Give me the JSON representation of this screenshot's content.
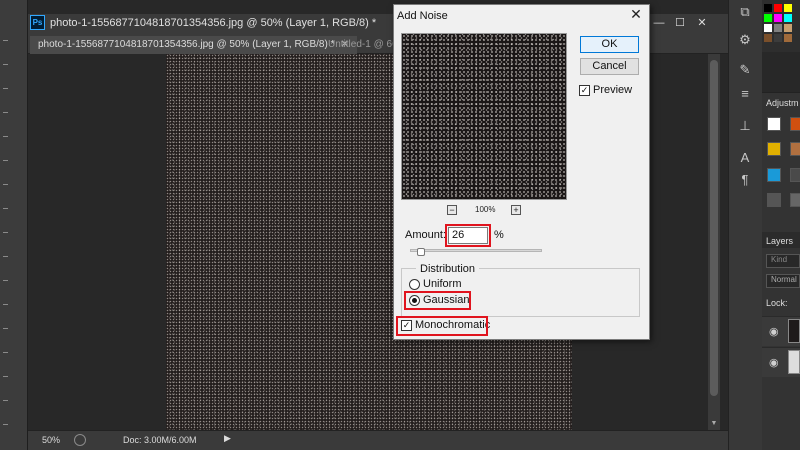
{
  "app": {
    "logo_text": "Ps",
    "window_title": "photo-1-1556877104818701354356.jpg @ 50% (Layer 1, RGB/8) *",
    "tabs": [
      {
        "label": "photo-1-1556877104818701354356.jpg @ 50% (Layer 1, RGB/8) *",
        "active": true
      },
      {
        "label": "Untitled-1 @ 66...",
        "active": false
      }
    ],
    "window_controls": {
      "minimize": "—",
      "maximize": "☐",
      "close": "✕"
    }
  },
  "status_bar": {
    "zoom": "50%",
    "doc": "Doc: 3.00M/6.00M",
    "arrow": "▶"
  },
  "right_panel": {
    "adjustments_tab": "Adjustm",
    "layers_tab": "Layers",
    "kind_placeholder": "Kind",
    "blend_mode": "Normal",
    "lock_label": "Lock:",
    "swatch_colors": [
      "#000000",
      "#ff0000",
      "#ffff00",
      "#00ff00",
      "#ff00ff",
      "#00ffff",
      "#ffffff",
      "#808080",
      "#c8a070",
      "#7a4f2a",
      "#3c3c3c",
      "#a06a3a"
    ]
  },
  "dialog": {
    "title": "Add Noise",
    "close_label": "✕",
    "ok_label": "OK",
    "cancel_label": "Cancel",
    "preview_label": "Preview",
    "preview_checked": true,
    "preview_zoom": "100%",
    "zoom_out": "−",
    "zoom_in": "+",
    "amount_label": "Amount:",
    "amount_value": "26",
    "amount_unit": "%",
    "amount_slider_fraction": 0.065,
    "distribution_label": "Distribution",
    "uniform_label": "Uniform",
    "gaussian_label": "Gaussian",
    "distribution_selected": "Gaussian",
    "monochromatic_label": "Monochromatic",
    "monochromatic_checked": true
  }
}
